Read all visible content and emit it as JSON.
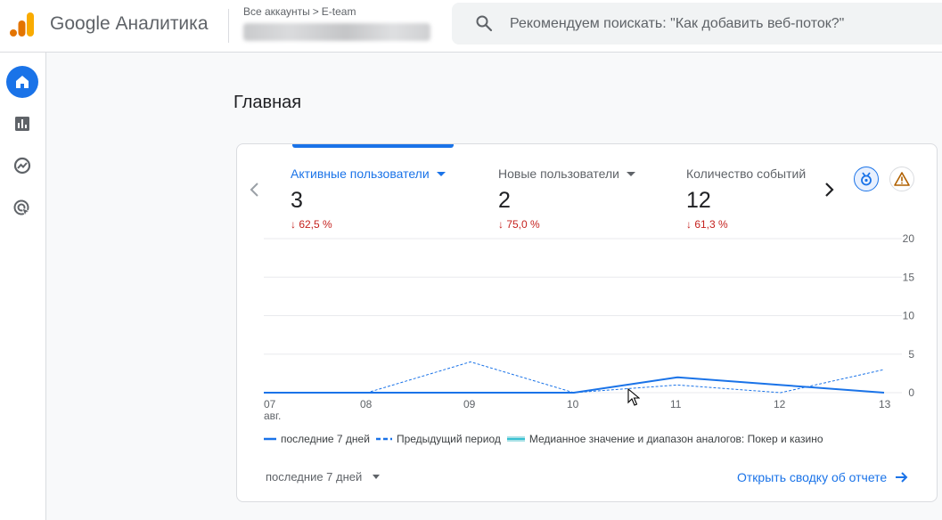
{
  "app": {
    "brand": "Google Аналитика",
    "breadcrumb": {
      "all_accounts": "Все аккаунты",
      "separator": ">",
      "account": "E-team"
    },
    "search": {
      "placeholder": "Рекомендуем поискать: \"Как добавить веб-поток?\""
    }
  },
  "sidebar": {
    "items": [
      {
        "name": "home",
        "icon": "home-icon",
        "active": true
      },
      {
        "name": "reports",
        "icon": "bar-chart-icon",
        "active": false
      },
      {
        "name": "explore",
        "icon": "explore-icon",
        "active": false
      },
      {
        "name": "advertising",
        "icon": "advertising-icon",
        "active": false
      }
    ]
  },
  "page": {
    "title": "Главная"
  },
  "card": {
    "metrics": [
      {
        "label": "Активные пользователи",
        "value": "3",
        "change": "↓ 62,5 %",
        "active": true,
        "dropdown": true
      },
      {
        "label": "Новые пользователи",
        "value": "2",
        "change": "↓ 75,0 %",
        "active": false,
        "dropdown": true
      },
      {
        "label": "Количество событий",
        "value": "12",
        "change": "↓ 61,3 %",
        "active": false,
        "dropdown": false
      }
    ],
    "legend": {
      "current": "последние 7 дней",
      "previous": "Предыдущий период",
      "benchmark": "Медианное значение и диапазон аналогов: Покер и казино"
    },
    "period_selector": "последние 7 дней",
    "open_report": "Открыть сводку об отчете"
  },
  "chart_data": {
    "type": "line",
    "x": [
      "07",
      "08",
      "09",
      "10",
      "11",
      "12",
      "13"
    ],
    "x_sublabel": "авг.",
    "ylim": [
      0,
      20
    ],
    "y_ticks": [
      "0",
      "5",
      "10",
      "15",
      "20"
    ],
    "series": [
      {
        "name": "последние 7 дней",
        "values": [
          0,
          0,
          0,
          0,
          2,
          1,
          0
        ],
        "color": "#1a73e8",
        "style": "solid"
      },
      {
        "name": "Предыдущий период",
        "values": [
          0,
          0,
          4,
          0,
          1,
          0,
          3
        ],
        "color": "#1a73e8",
        "style": "dashed"
      }
    ],
    "grid": true
  },
  "colors": {
    "accent": "#1a73e8",
    "negative": "#c5221f",
    "orange": "#f9ab00",
    "orange_dark": "#e37400"
  }
}
